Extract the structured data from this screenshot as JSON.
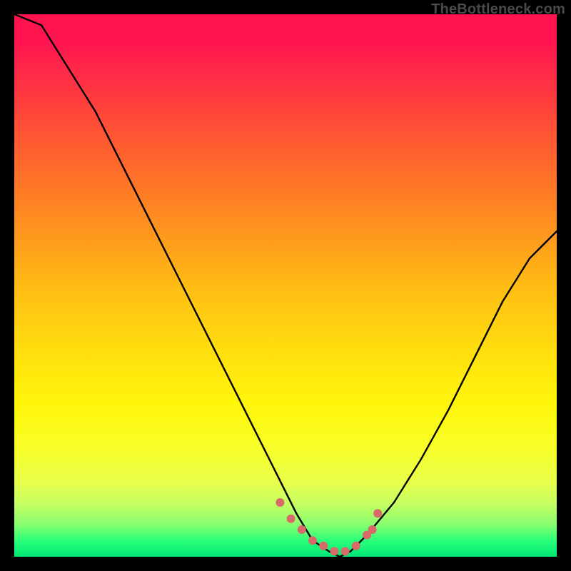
{
  "watermark": {
    "text": "TheBottleneck.com"
  },
  "colors": {
    "curve": "#000000",
    "dots": "#d96a6a",
    "dots_outline": "#d96a6a"
  },
  "chart_data": {
    "type": "line",
    "title": "",
    "xlabel": "",
    "ylabel": "",
    "xlim": [
      0,
      100
    ],
    "ylim": [
      0,
      100
    ],
    "grid": false,
    "legend": false,
    "description": "V-shaped bottleneck curve over vertical rainbow gradient (red at top → green at bottom). Curve hits ~0 near x≈55–63 then rises again. Pink dots trace the valley floor.",
    "series": [
      {
        "name": "bottleneck-curve",
        "x": [
          0,
          5,
          10,
          15,
          20,
          25,
          30,
          35,
          40,
          45,
          50,
          52,
          55,
          58,
          60,
          62,
          65,
          70,
          75,
          80,
          85,
          90,
          95,
          100
        ],
        "y": [
          100,
          98,
          90,
          82,
          72,
          62,
          52,
          42,
          32,
          22,
          12,
          8,
          3,
          1,
          0,
          1,
          4,
          10,
          18,
          27,
          37,
          47,
          55,
          60
        ]
      }
    ],
    "dots": {
      "name": "valley-dots",
      "points": [
        {
          "x": 49,
          "y": 10
        },
        {
          "x": 51,
          "y": 7
        },
        {
          "x": 53,
          "y": 5
        },
        {
          "x": 55,
          "y": 3
        },
        {
          "x": 57,
          "y": 2
        },
        {
          "x": 59,
          "y": 1
        },
        {
          "x": 61,
          "y": 1
        },
        {
          "x": 63,
          "y": 2
        },
        {
          "x": 65,
          "y": 4
        },
        {
          "x": 66,
          "y": 5
        },
        {
          "x": 67,
          "y": 8
        }
      ]
    }
  }
}
